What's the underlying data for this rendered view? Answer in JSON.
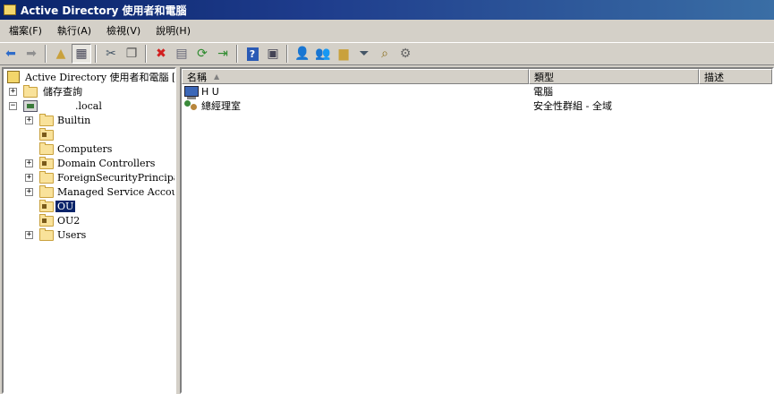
{
  "window": {
    "title": "Active Directory 使用者和電腦"
  },
  "menu": [
    "檔案(F)",
    "執行(A)",
    "檢視(V)",
    "說明(H)"
  ],
  "toolbar": {
    "icons": [
      "back-arrow-icon",
      "forward-arrow-icon",
      "up-folder-icon",
      "show-hide-tree-icon",
      "cut-icon",
      "copy-icon",
      "delete-icon",
      "properties-icon",
      "refresh-icon",
      "export-list-icon",
      "help-icon",
      "show-hide-action-pane-icon",
      "create-user-icon",
      "create-group-icon",
      "create-ou-icon",
      "filter-icon",
      "find-icon",
      "add-to-group-icon"
    ]
  },
  "tree": {
    "root": "Active Directory 使用者和電腦 [A",
    "items": [
      {
        "label": "儲存查詢",
        "expander": "+"
      },
      {
        "label": ".local",
        "expander": "−"
      },
      {
        "label": "Builtin",
        "expander": "+"
      },
      {
        "label": "",
        "expander": ""
      },
      {
        "label": "Computers",
        "expander": ""
      },
      {
        "label": "Domain Controllers",
        "expander": "+"
      },
      {
        "label": "ForeignSecurityPrincipals",
        "expander": "+"
      },
      {
        "label": "Managed Service Accounts",
        "expander": "+"
      },
      {
        "label": "OU",
        "expander": ""
      },
      {
        "label": "OU2",
        "expander": ""
      },
      {
        "label": "Users",
        "expander": "+"
      }
    ]
  },
  "list": {
    "columns": [
      "名稱",
      "類型",
      "描述"
    ],
    "rows": [
      {
        "name": "H        U",
        "type": "電腦"
      },
      {
        "name": "總經理室",
        "type": "安全性群組 - 全域"
      }
    ]
  },
  "colors": {
    "title_gradient_start": "#0a246a",
    "title_gradient_end": "#3a6ea5",
    "selection": "#0a246a",
    "chrome": "#d4d0c8"
  }
}
